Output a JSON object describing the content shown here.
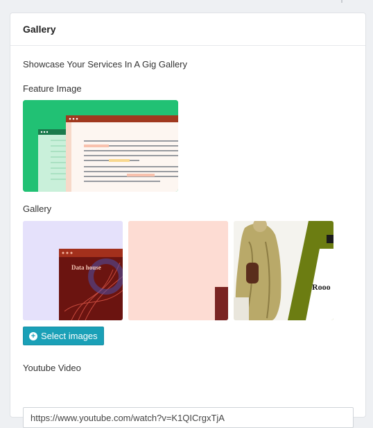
{
  "card": {
    "title": "Gallery"
  },
  "body": {
    "showcase_text": "Showcase Your Services In A Gig Gallery",
    "feature_label": "Feature Image",
    "gallery_label": "Gallery",
    "select_button_label": "Select images",
    "youtube_label": "Youtube Video",
    "youtube_value": "https://www.youtube.com/watch?v=K1QICrgxTjA"
  },
  "gallery_items": [
    {
      "caption": "Data house"
    },
    {
      "caption": ""
    },
    {
      "caption": "Rooo"
    }
  ],
  "colors": {
    "accent": "#1aa0b7",
    "feature_bg": "#21c174",
    "gallery1_bg": "#e5e1fb",
    "gallery2_bg": "#fddcd3"
  }
}
